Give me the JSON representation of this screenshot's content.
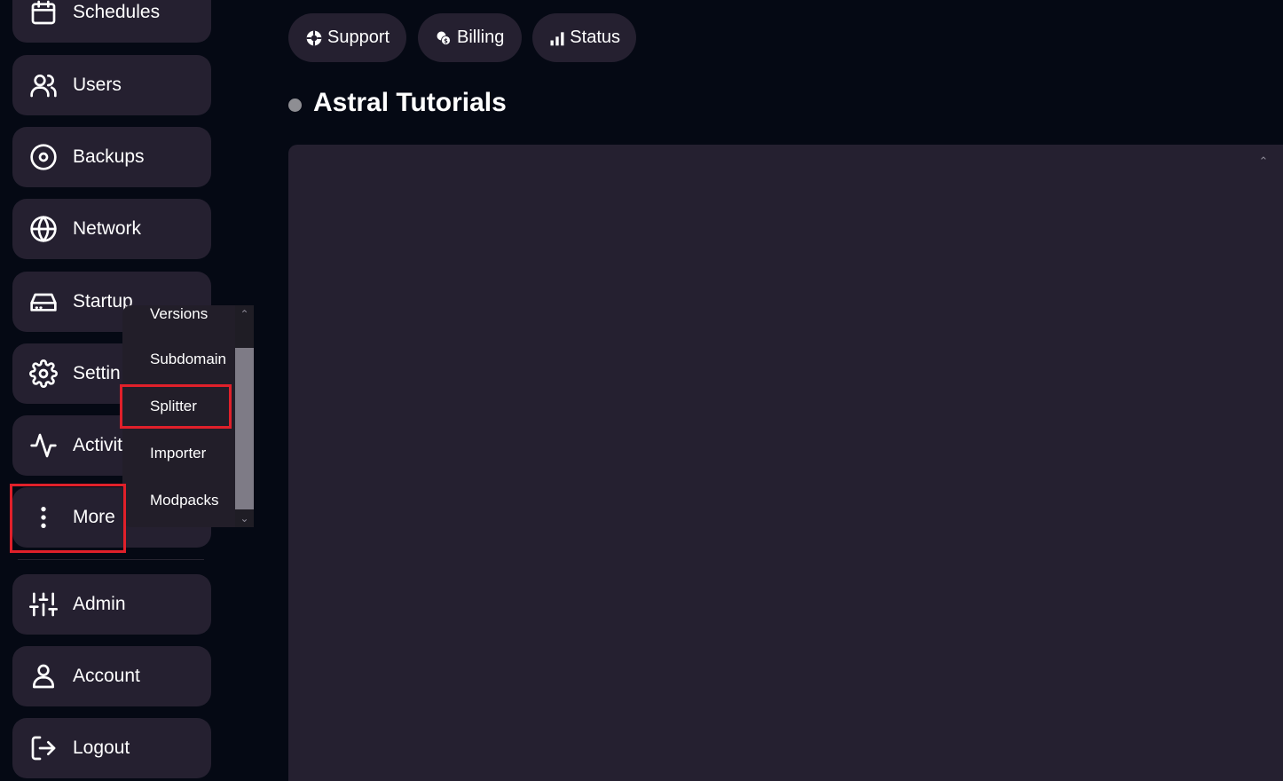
{
  "sidebar": {
    "items": [
      {
        "label": "Schedules",
        "icon": "calendar-icon"
      },
      {
        "label": "Users",
        "icon": "users-icon"
      },
      {
        "label": "Backups",
        "icon": "backup-disc-icon"
      },
      {
        "label": "Network",
        "icon": "globe-icon"
      },
      {
        "label": "Startup",
        "icon": "hard-drive-icon"
      },
      {
        "label": "Settin",
        "icon": "gear-icon"
      },
      {
        "label": "Activit",
        "icon": "activity-icon"
      },
      {
        "label": "More",
        "icon": "more-vertical-icon"
      }
    ],
    "bottom_items": [
      {
        "label": "Admin",
        "icon": "sliders-icon"
      },
      {
        "label": "Account",
        "icon": "user-icon"
      },
      {
        "label": "Logout",
        "icon": "logout-icon"
      }
    ]
  },
  "dropdown": {
    "items": [
      "Versions",
      "Subdomain",
      "Splitter",
      "Importer",
      "Modpacks"
    ]
  },
  "top_buttons": [
    {
      "label": "Support",
      "icon": "lifebuoy-icon"
    },
    {
      "label": "Billing",
      "icon": "coins-icon"
    },
    {
      "label": "Status",
      "icon": "signal-bars-icon"
    }
  ],
  "page": {
    "title": "Astral Tutorials"
  },
  "colors": {
    "background": "#050914",
    "card": "#252030",
    "highlight": "#e0202a"
  }
}
